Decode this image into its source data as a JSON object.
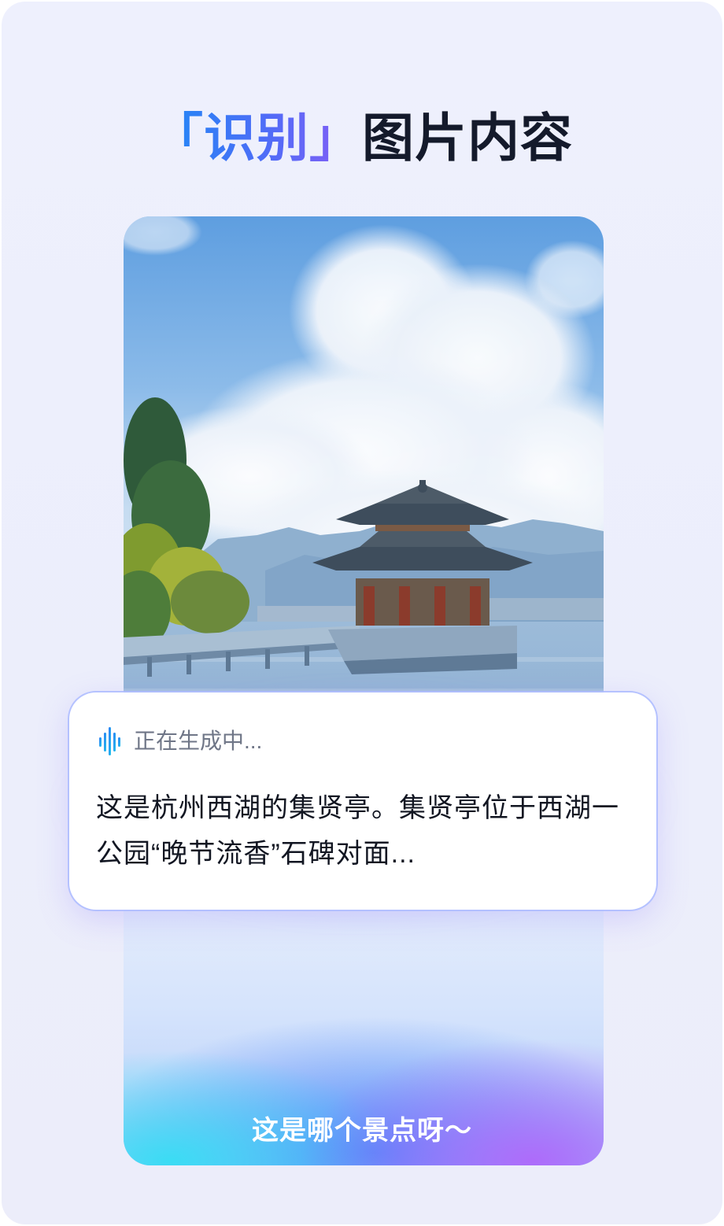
{
  "headline": {
    "accent": "「识别」",
    "rest": "图片内容"
  },
  "photo": {
    "subject": "pavilion-by-lake"
  },
  "answer_card": {
    "icon": "voice-wave-icon",
    "status": "正在生成中...",
    "text": "这是杭州西湖的集贤亭。集贤亭位于西湖一公园“晚节流香”石碑对面..."
  },
  "query": {
    "text": "这是哪个景点呀～"
  },
  "colors": {
    "accent_start": "#1c8bf5",
    "accent_end": "#8b5cf6",
    "text_dark": "#141a2b",
    "status_gray": "#6f7687"
  }
}
